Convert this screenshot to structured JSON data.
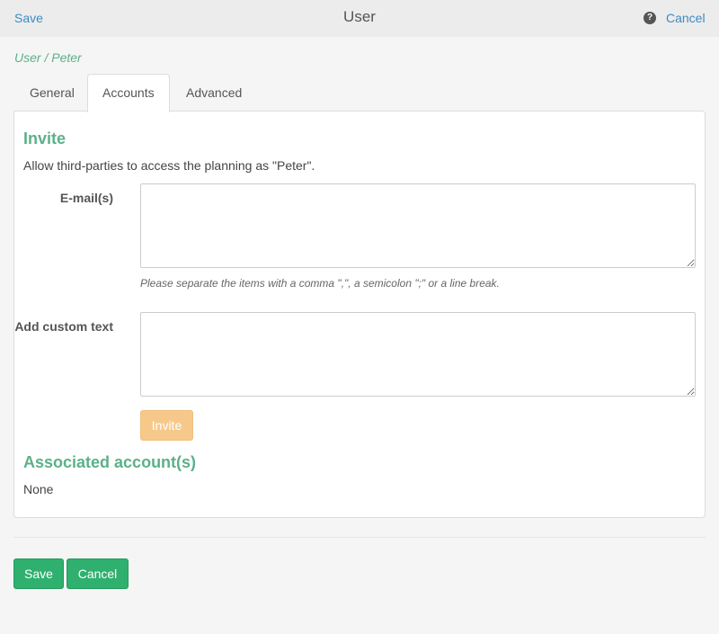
{
  "topbar": {
    "save_label": "Save",
    "title": "User",
    "help_glyph": "?",
    "cancel_label": "Cancel"
  },
  "breadcrumb": "User / Peter",
  "tabs": [
    {
      "label": "General",
      "active": false
    },
    {
      "label": "Accounts",
      "active": true
    },
    {
      "label": "Advanced",
      "active": false
    }
  ],
  "invite": {
    "heading": "Invite",
    "description": "Allow third-parties to access the planning as \"Peter\".",
    "emails_label": "E-mail(s)",
    "emails_value": "",
    "emails_hint": "Please separate the items with a comma \",\", a semicolon \";\" or a line break.",
    "custom_text_label": "Add custom text",
    "custom_text_value": "",
    "invite_button": "Invite"
  },
  "associated": {
    "heading": "Associated account(s)",
    "value": "None"
  },
  "footer": {
    "save_label": "Save",
    "cancel_label": "Cancel"
  },
  "colors": {
    "accent_green": "#5cb08a",
    "button_green": "#2fb06e",
    "invite_orange": "#f6c98b",
    "link_blue": "#3a8dc4"
  }
}
